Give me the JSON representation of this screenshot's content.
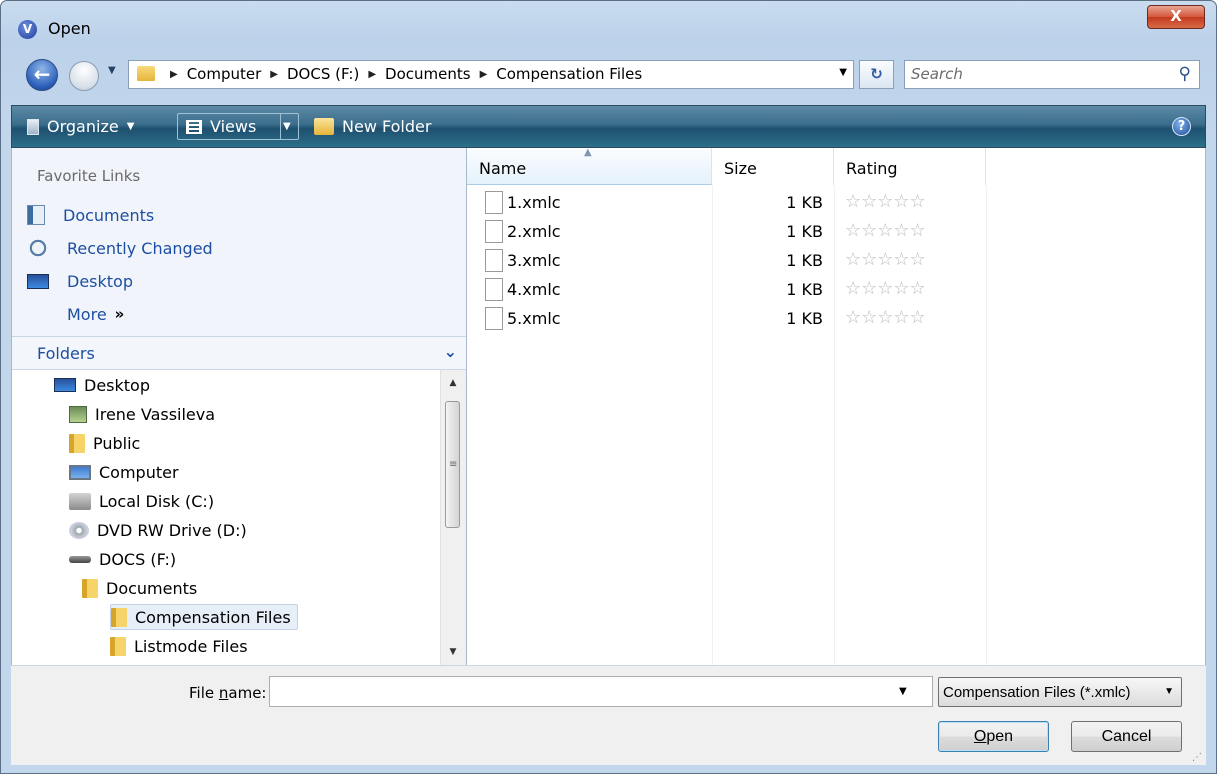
{
  "window": {
    "title": "Open",
    "app_icon": "V",
    "close_label": "X"
  },
  "address": {
    "crumbs": [
      "Computer",
      "DOCS (F:)",
      "Documents",
      "Compensation Files"
    ],
    "search_placeholder": "Search"
  },
  "toolbar": {
    "organize": "Organize",
    "views": "Views",
    "new_folder": "New Folder",
    "help": "?"
  },
  "favorites": {
    "heading": "Favorite Links",
    "items": [
      {
        "label": "Documents",
        "icon": "documents-icon"
      },
      {
        "label": "Recently Changed",
        "icon": "recently-changed-icon"
      },
      {
        "label": "Desktop",
        "icon": "desktop-icon"
      }
    ],
    "more": "More",
    "more_chevron": "»"
  },
  "folders": {
    "label": "Folders",
    "tree": [
      {
        "label": "Desktop",
        "icon": "desktop-icon",
        "depth": 0
      },
      {
        "label": "Irene Vassileva",
        "icon": "user-folder-icon",
        "depth": 1
      },
      {
        "label": "Public",
        "icon": "folder-icon",
        "depth": 1
      },
      {
        "label": "Computer",
        "icon": "computer-icon",
        "depth": 1
      },
      {
        "label": "Local Disk (C:)",
        "icon": "local-disk-icon",
        "depth": 2
      },
      {
        "label": "DVD RW Drive (D:)",
        "icon": "dvd-drive-icon",
        "depth": 2
      },
      {
        "label": "DOCS (F:)",
        "icon": "drive-icon",
        "depth": 2
      },
      {
        "label": "Documents",
        "icon": "folder-icon",
        "depth": 3
      },
      {
        "label": "Compensation Files",
        "icon": "folder-icon",
        "depth": 4,
        "selected": true
      },
      {
        "label": "Listmode Files",
        "icon": "folder-icon",
        "depth": 4
      }
    ]
  },
  "filelist": {
    "columns": [
      "Name",
      "Size",
      "Rating"
    ],
    "sorted_column": "Name",
    "files": [
      {
        "name": "1.xmlc",
        "size": "1 KB",
        "rating": 0
      },
      {
        "name": "2.xmlc",
        "size": "1 KB",
        "rating": 0
      },
      {
        "name": "3.xmlc",
        "size": "1 KB",
        "rating": 0
      },
      {
        "name": "4.xmlc",
        "size": "1 KB",
        "rating": 0
      },
      {
        "name": "5.xmlc",
        "size": "1 KB",
        "rating": 0
      }
    ],
    "rating_max": 5
  },
  "bottom": {
    "file_name_label": "File name:",
    "file_name_value": "",
    "filter": "Compensation Files (*.xmlc)",
    "open_label": "Open",
    "cancel_label": "Cancel"
  },
  "colors": {
    "link": "#1e4ea1",
    "command_bar": "#1e5070",
    "close_button": "#c23a1e"
  }
}
